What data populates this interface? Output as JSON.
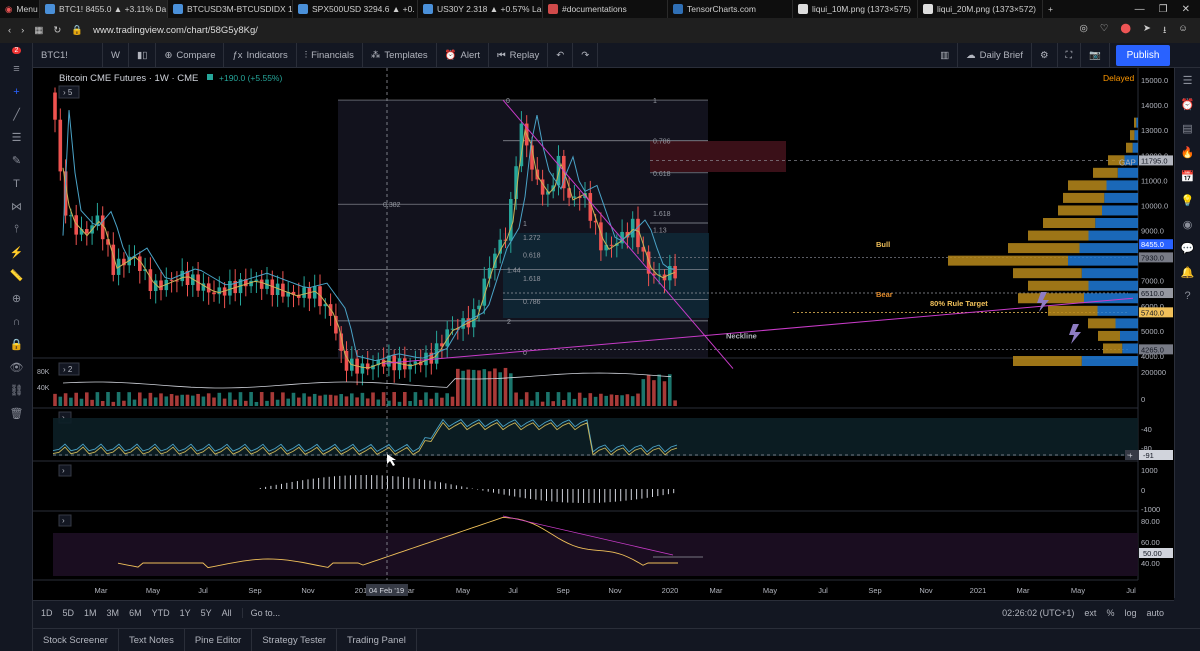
{
  "browser": {
    "menu_label": "Menu",
    "tabs": [
      {
        "label": "BTC1! 8455.0 ▲ +3.11% Da"
      },
      {
        "label": "BTCUSD3M-BTCUSDIDX 19"
      },
      {
        "label": "SPX500USD 3294.6 ▲ +0."
      },
      {
        "label": "US30Y 2.318 ▲ +0.57% La"
      },
      {
        "label": "#documentations"
      },
      {
        "label": "TensorCharts.com"
      },
      {
        "label": "liqui_10M.png (1373×575)"
      },
      {
        "label": "liqui_20M.png (1373×572)"
      }
    ],
    "url": "www.tradingview.com/chart/58G5y8Kg/"
  },
  "toolbar": {
    "symbol": "BTC1!",
    "interval": "W",
    "compare": "Compare",
    "indicators": "Indicators",
    "financials": "Financials",
    "templates": "Templates",
    "alert": "Alert",
    "replay": "Replay",
    "layout_name": "Daily Brief",
    "publish": "Publish"
  },
  "chart": {
    "title": "Bitcoin CME Futures · 1W · CME",
    "change": "+190.0 (+5.55%)",
    "status": "Delayed",
    "collapsed_studies_main": "5",
    "collapsed_studies_vol": "2",
    "volume_label": "80K",
    "volume_label2": "40K",
    "price_axis": [
      "15000.0",
      "14000.0",
      "13000.0",
      "12000.0",
      "11000.0",
      "10000.0",
      "9000.0",
      "8000.0",
      "7000.0",
      "6000.0",
      "5000.0",
      "4000.0"
    ],
    "price_tags": [
      {
        "label": "11795.0",
        "color": "#b2b5be"
      },
      {
        "label": "8455.0",
        "color": "#2962ff"
      },
      {
        "label": "7930.0",
        "color": "#787b86"
      },
      {
        "label": "6510.0",
        "color": "#9598a1"
      },
      {
        "label": "5740.0",
        "color": "#f0c05a"
      },
      {
        "label": "4265.0",
        "color": "#787b86"
      }
    ],
    "annotations": {
      "bull": "Bull",
      "bear": "Bear",
      "rule80": "80% Rule Target",
      "neckline": "Neckline",
      "gap": "GAP"
    },
    "fib_levels": [
      "0",
      "1",
      "0.786",
      "0.618",
      "0.382",
      "1.618",
      "1",
      "1.13",
      "1.272",
      "0.618",
      "1.44",
      "1.618",
      "0.786",
      "2",
      "0"
    ],
    "vol_axis": [
      "200000",
      "0"
    ],
    "osc1_axis": [
      "-40",
      "-80"
    ],
    "osc1_tag": "-91",
    "osc2_axis": [
      "1000",
      "0",
      "-1000"
    ],
    "rsi_axis": [
      "80.00",
      "60.00",
      "50.00",
      "40.00"
    ],
    "time_axis": [
      "Mar",
      "May",
      "Jul",
      "Sep",
      "Nov",
      "2019",
      "Mar",
      "May",
      "Jul",
      "Sep",
      "Nov",
      "2020",
      "Mar",
      "May",
      "Jul",
      "Sep",
      "Nov",
      "2021",
      "Mar",
      "May",
      "Jul"
    ],
    "crosshair_date": "04 Feb '19"
  },
  "bottom": {
    "ranges": [
      "1D",
      "5D",
      "1M",
      "3M",
      "6M",
      "YTD",
      "1Y",
      "5Y",
      "All"
    ],
    "goto": "Go to...",
    "clock": "02:26:02 (UTC+1)",
    "ext": "ext",
    "pct": "%",
    "log": "log",
    "auto": "auto",
    "panels": [
      "Stock Screener",
      "Text Notes",
      "Pine Editor",
      "Strategy Tester",
      "Trading Panel"
    ]
  },
  "colors": {
    "up": "#26a69a",
    "down": "#ef5350",
    "accent": "#2962ff",
    "bg": "#131722"
  }
}
